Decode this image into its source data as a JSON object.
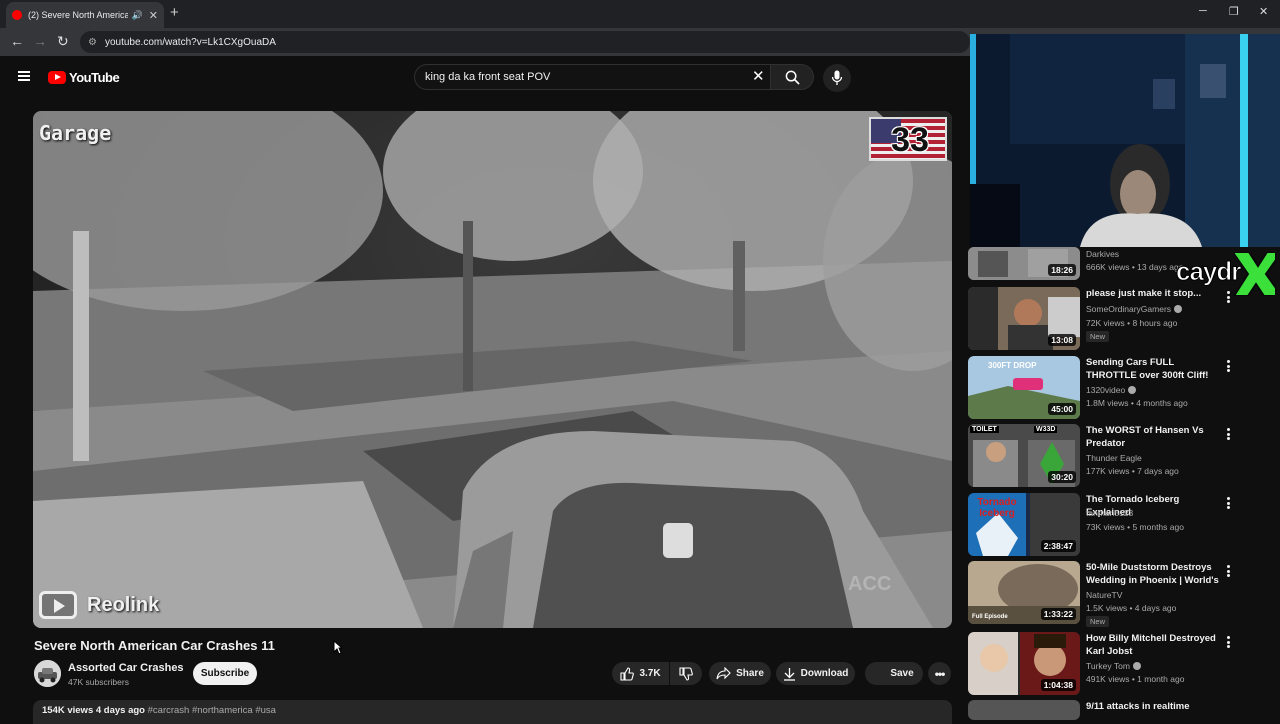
{
  "browser": {
    "tab_title": "(2) Severe North American",
    "url": "youtube.com/watch?v=Lk1CXgOuaDA",
    "new_tab": "+",
    "tab_close": "✕"
  },
  "youtube": {
    "logo_text": "YouTube",
    "search_value": "king da ka front seat  POV",
    "search_clear": "✕"
  },
  "video": {
    "camera_label": "Garage",
    "flag_number": "33",
    "brand_overlay": "Reolink",
    "watermark": "ACC",
    "title": "Severe North American Car Crashes 11"
  },
  "channel": {
    "name": "Assorted Car Crashes",
    "subscribers": "47K subscribers",
    "subscribe_label": "Subscribe"
  },
  "actions": {
    "like_count": "3.7K",
    "share_label": "Share",
    "download_label": "Download",
    "save_label": "Save"
  },
  "description": {
    "meta": "154K views  4 days ago",
    "tags": "#carcrash #northamerica #usa"
  },
  "overlay": {
    "streamer_tag": "caydr"
  },
  "recommendations": [
    {
      "title": "",
      "channel": "Darkives",
      "meta": "666K views • 13 days ago",
      "duration": "18:26",
      "badge": ""
    },
    {
      "title": "please just make it stop...",
      "channel": "SomeOrdinaryGamers",
      "meta": "72K views • 8 hours ago",
      "duration": "13:08",
      "badge": "New"
    },
    {
      "title": "Sending Cars FULL THROTTLE over 300ft Cliff! (Alaska's 202...",
      "channel": "1320video",
      "meta": "1.8M views • 4 months ago",
      "duration": "45:00",
      "badge": ""
    },
    {
      "title": "The WORST of Hansen Vs Predator",
      "channel": "Thunder Eagle",
      "meta": "177K views • 7 days ago",
      "duration": "30:20",
      "badge": ""
    },
    {
      "title": "The Tornado Iceberg Explained",
      "channel": "tanman5123",
      "meta": "73K views • 5 months ago",
      "duration": "2:38:47",
      "badge": ""
    },
    {
      "title": "50-Mile Duststorm Destroys Wedding in Phoenix | World's ...",
      "channel": "NatureTV",
      "meta": "1.5K views • 4 days ago",
      "duration": "1:33:22",
      "badge": "New"
    },
    {
      "title": "How Billy Mitchell Destroyed Karl Jobst",
      "channel": "Turkey Tom",
      "meta": "491K views • 1 month ago",
      "duration": "1:04:38",
      "badge": ""
    },
    {
      "title": "9/11 attacks in realtime",
      "channel": "",
      "meta": "",
      "duration": "",
      "badge": ""
    }
  ],
  "thumb_text": {
    "tornado": "Tornado Iceberg",
    "duststorm": "Full Episode",
    "toilet": "TOILET",
    "weed": "W33D"
  }
}
